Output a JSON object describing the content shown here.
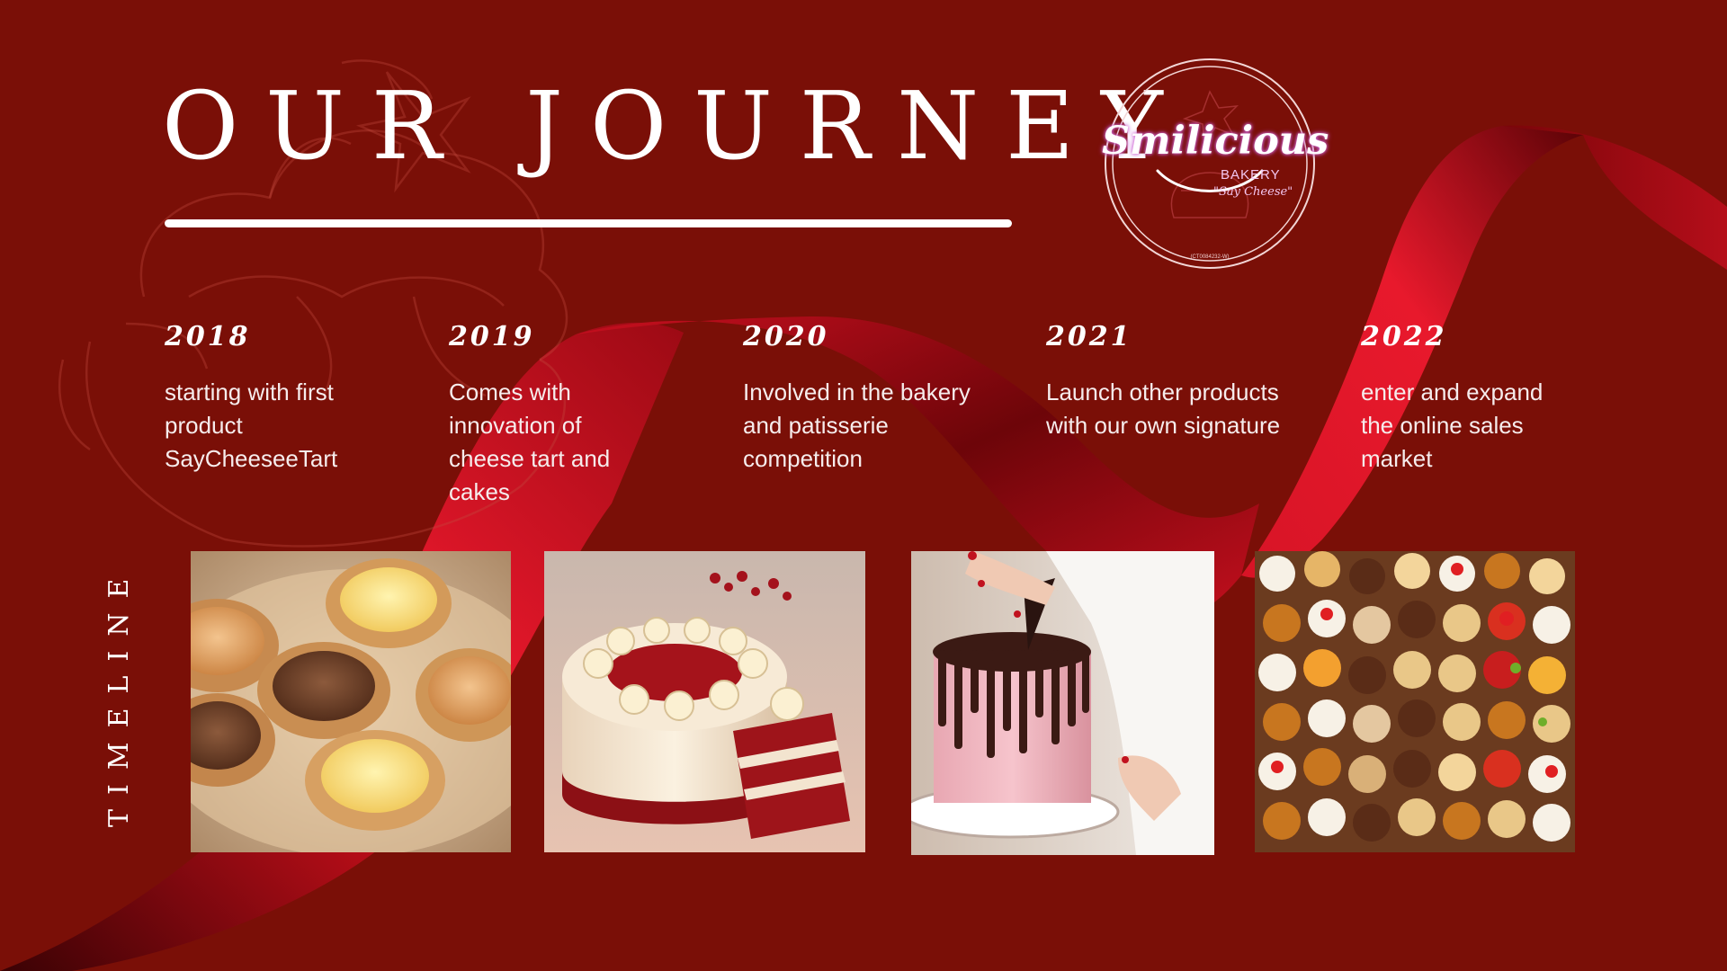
{
  "header": {
    "title": "OUR JOURNEY"
  },
  "logo": {
    "name": "Smilicious",
    "subtitle": "BAKERY",
    "tagline": "\"Say Cheese\"",
    "registration": "(CT0084232-W)"
  },
  "milestones": [
    {
      "year": "2018",
      "description": "starting with first\nproduct\nSayCheeseeTart"
    },
    {
      "year": "2019",
      "description": "Comes with\ninnovation of\ncheese tart and\ncakes"
    },
    {
      "year": "2020",
      "description": "Involved in the bakery\nand patisserie\ncompetition"
    },
    {
      "year": "2021",
      "description": "Launch other products\nwith our own signature"
    },
    {
      "year": "2022",
      "description": "enter and expand\nthe online sales\nmarket"
    }
  ],
  "side_label": "TIMELINE",
  "photos": [
    {
      "subject": "cheese tarts"
    },
    {
      "subject": "red velvet cake"
    },
    {
      "subject": "chocolate drip cake"
    },
    {
      "subject": "assorted petit fours"
    }
  ],
  "colors": {
    "background": "#7a0f07",
    "ribbon": "#d4121f",
    "ribbon_shadow": "#4a0305",
    "text": "#ffffff"
  }
}
